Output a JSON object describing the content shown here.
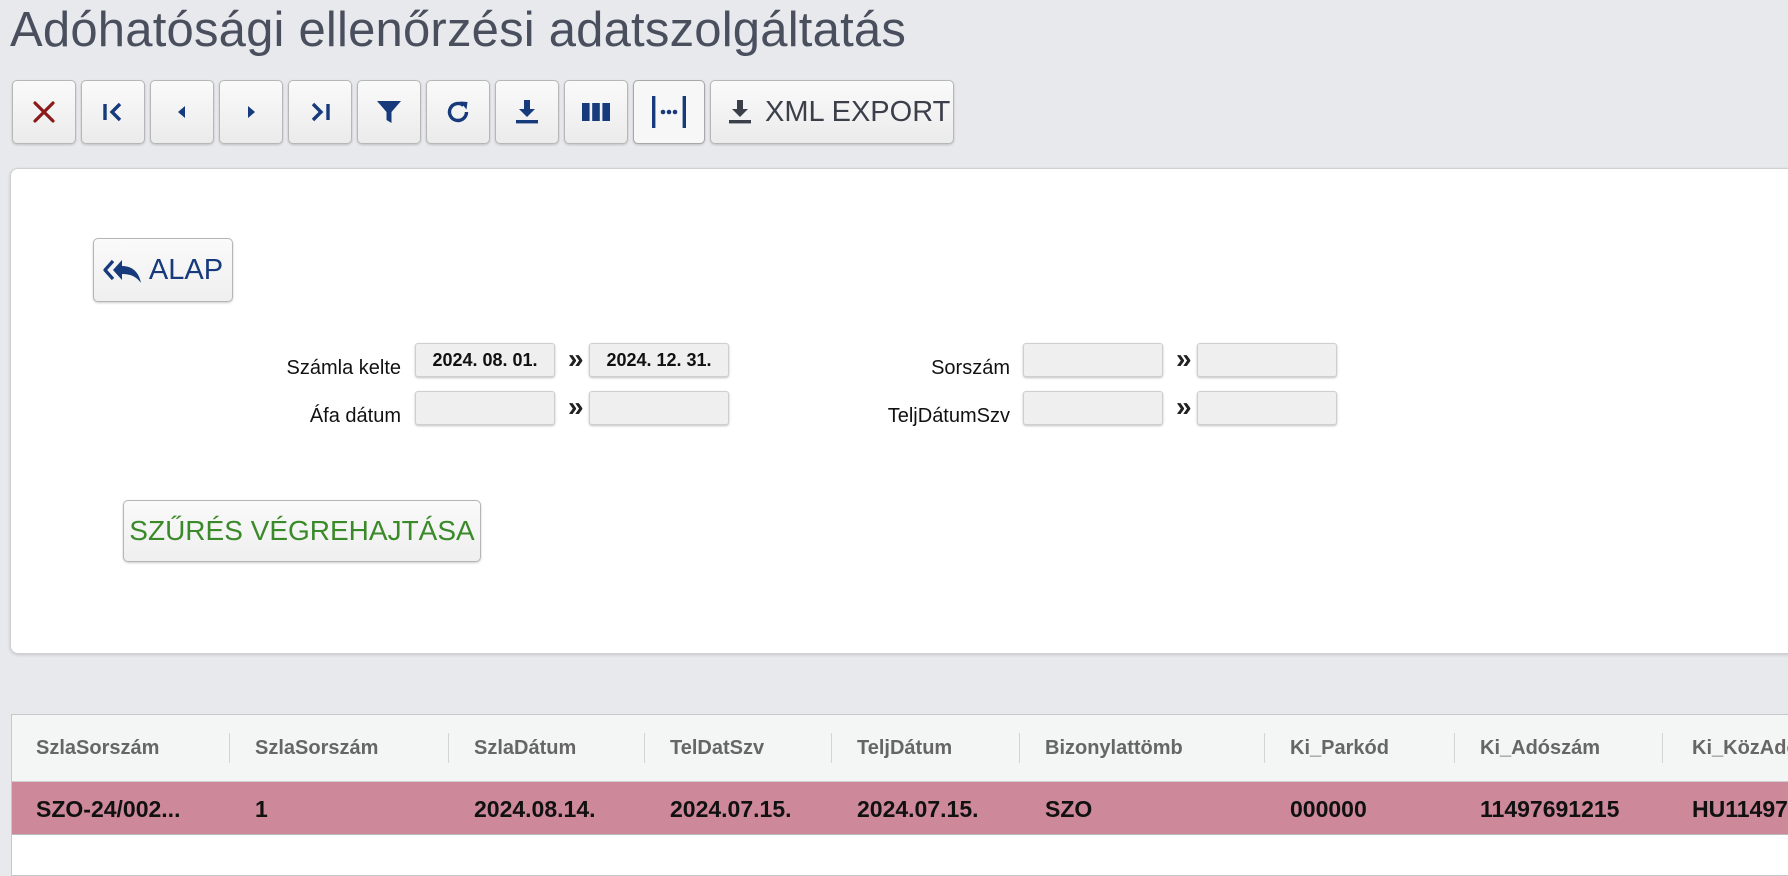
{
  "page": {
    "title": "Adóhatósági ellenőrzési adatszolgáltatás"
  },
  "toolbar": {
    "buttons": [
      {
        "icon": "close-icon",
        "color": "#8b1a1a"
      },
      {
        "icon": "first-page-icon"
      },
      {
        "icon": "previous-icon"
      },
      {
        "icon": "next-icon"
      },
      {
        "icon": "last-page-icon"
      },
      {
        "icon": "filter-icon"
      },
      {
        "icon": "refresh-icon"
      },
      {
        "icon": "download-icon"
      },
      {
        "icon": "columns-icon"
      },
      {
        "icon": "fit-width-icon"
      }
    ],
    "xml_export_label": "XML EXPORT",
    "accent_color": "#163a7c"
  },
  "filter": {
    "back_button_label": "ALAP",
    "fields": {
      "szamla_kelte": {
        "label": "Számla kelte",
        "from": "2024. 08. 01.",
        "to": "2024. 12. 31."
      },
      "afa_datum": {
        "label": "Áfa dátum",
        "from": "",
        "to": ""
      },
      "sorszam": {
        "label": "Sorszám",
        "from": "",
        "to": ""
      },
      "telj_datum_szv": {
        "label": "TeljDátumSzv",
        "from": "",
        "to": ""
      }
    },
    "range_separator": "»",
    "run_button_label": "SZŰRÉS VÉGREHAJTÁSA",
    "run_button_color": "#3b8a2a"
  },
  "grid": {
    "columns": [
      "SzlaSorszám",
      "SzlaSorszám",
      "SzlaDátum",
      "TelDatSzv",
      "TeljDátum",
      "Bizonylattömb",
      "Ki_Parkód",
      "Ki_Adószám",
      "Ki_KözAdó"
    ],
    "rows": [
      [
        "SZO-24/002...",
        "1",
        "2024.08.14.",
        "2024.07.15.",
        "2024.07.15.",
        "SZO",
        "000000",
        "11497691215",
        "HU11497"
      ]
    ],
    "selected_row_color": "#cd8899"
  }
}
